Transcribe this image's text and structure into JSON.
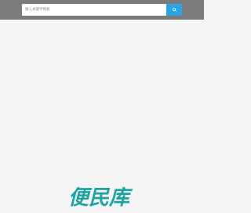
{
  "search": {
    "placeholder": "输入关键字搜索",
    "button_icon": "search-icon"
  },
  "brand": {
    "logo_text": "便民库",
    "logo_color": "#1ea3a0"
  },
  "colors": {
    "topbar": "#7b7b7b",
    "background": "#f4f4f4",
    "accent": "#2ba4e6"
  }
}
